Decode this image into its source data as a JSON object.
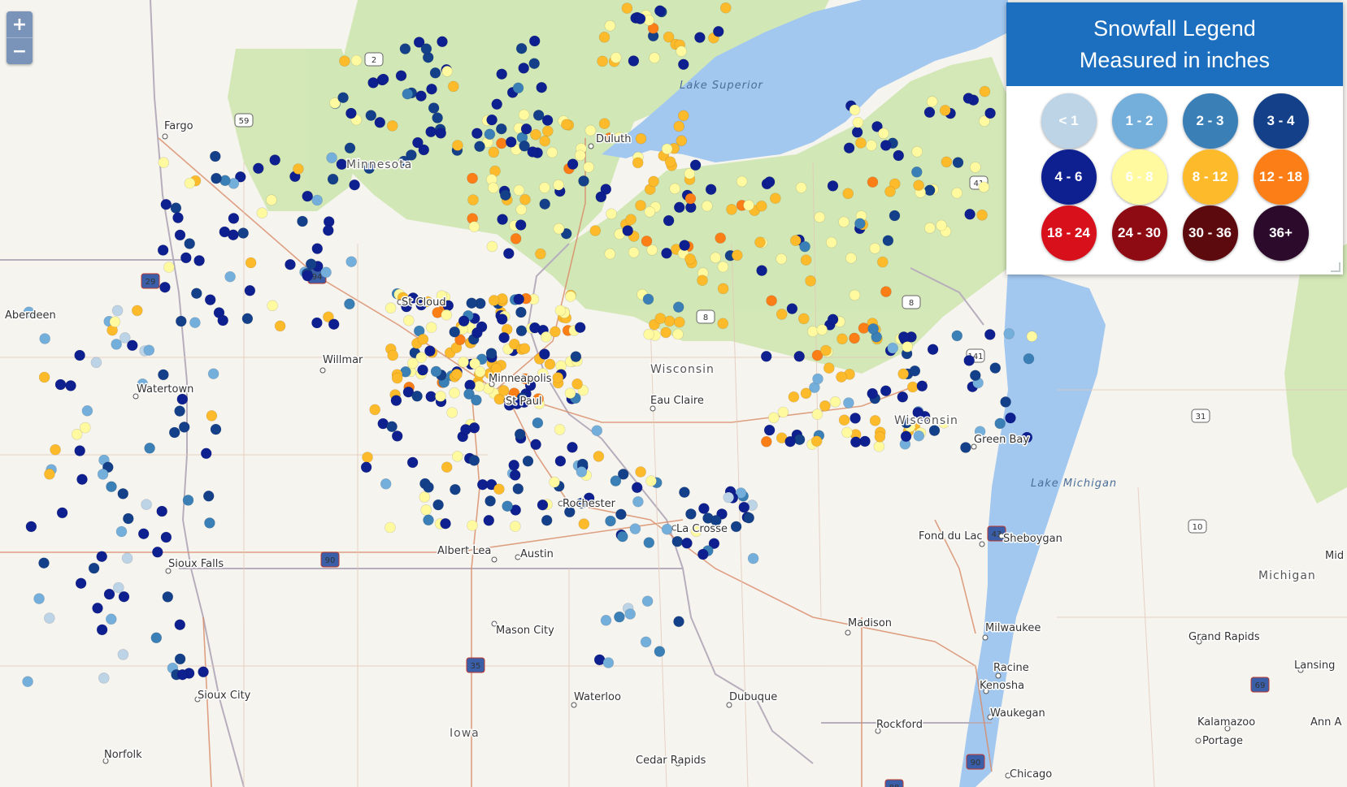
{
  "zoom": {
    "in_label": "+",
    "out_label": "−"
  },
  "legend": {
    "title_line1": "Snowfall Legend",
    "title_line2": "Measured in inches",
    "items": [
      {
        "label": "< 1",
        "color": "#bdd3e6",
        "text_color": "#ffffff"
      },
      {
        "label": "1 - 2",
        "color": "#74aedb",
        "text_color": "#ffffff"
      },
      {
        "label": "2 - 3",
        "color": "#3a7fb6",
        "text_color": "#ffffff"
      },
      {
        "label": "3 - 4",
        "color": "#14408a",
        "text_color": "#ffffff"
      },
      {
        "label": "4 - 6",
        "color": "#0e1f8f",
        "text_color": "#ffffff"
      },
      {
        "label": "6 - 8",
        "color": "#fffaa0",
        "text_color": "#ffffff"
      },
      {
        "label": "8 - 12",
        "color": "#fdbb2b",
        "text_color": "#ffffff"
      },
      {
        "label": "12 - 18",
        "color": "#fb7e17",
        "text_color": "#ffffff"
      },
      {
        "label": "18 - 24",
        "color": "#d7101b",
        "text_color": "#ffffff"
      },
      {
        "label": "24 - 30",
        "color": "#8f0b13",
        "text_color": "#ffffff"
      },
      {
        "label": "30 - 36",
        "color": "#5c0a0d",
        "text_color": "#ffffff"
      },
      {
        "label": "36+",
        "color": "#2c0a2c",
        "text_color": "#ffffff"
      }
    ]
  },
  "map_labels": {
    "states": [
      "Minnesota",
      "Wisconsin",
      "Wisconsin",
      "Iowa",
      "Michigan"
    ],
    "water": [
      "Lake Superior",
      "Lake Michigan"
    ],
    "cities": [
      "Fargo",
      "Duluth",
      "St Cloud",
      "Willmar",
      "Aberdeen",
      "Watertown",
      "Minneapolis",
      "St Paul",
      "Eau Claire",
      "Green Bay",
      "Rochester",
      "La Crosse",
      "Albert Lea",
      "Austin",
      "Sioux Falls",
      "Fond du Lac",
      "Sheboygan",
      "Madison",
      "Milwaukee",
      "Mason City",
      "Sioux City",
      "Waterloo",
      "Dubuque",
      "Rockford",
      "Racine",
      "Kenosha",
      "Waukegan",
      "Chicago",
      "Cedar Rapids",
      "Norfolk",
      "Grand Rapids",
      "Lansing",
      "Kalamazoo",
      "Portage",
      "Ann A",
      "Mid"
    ]
  }
}
